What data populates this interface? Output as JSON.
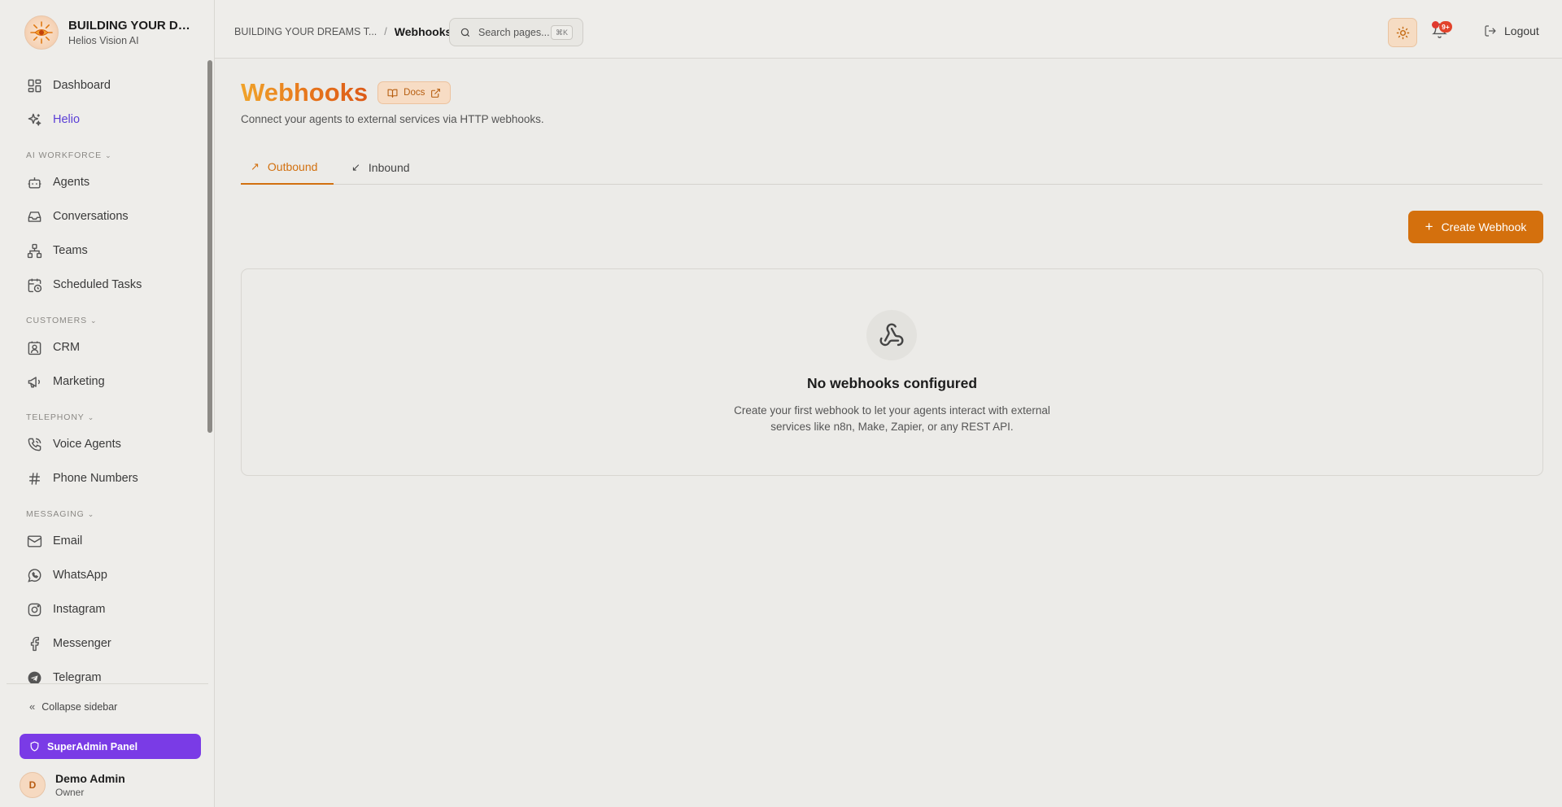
{
  "brand": {
    "title": "BUILDING YOUR DRE...",
    "subtitle": "Helios Vision AI"
  },
  "sidebar": {
    "items_top": [
      {
        "label": "Dashboard",
        "icon": "dashboard-icon"
      },
      {
        "label": "Helio",
        "icon": "sparkles-icon",
        "active": true
      }
    ],
    "sections": {
      "ai_workforce": "AI WORKFORCE",
      "customers": "CUSTOMERS",
      "telephony": "TELEPHONY",
      "messaging": "MESSAGING"
    },
    "ai_workforce_items": [
      {
        "label": "Agents",
        "icon": "bot-icon"
      },
      {
        "label": "Conversations",
        "icon": "inbox-icon"
      },
      {
        "label": "Teams",
        "icon": "network-icon"
      },
      {
        "label": "Scheduled Tasks",
        "icon": "calendar-clock-icon"
      }
    ],
    "customers_items": [
      {
        "label": "CRM",
        "icon": "contact-icon"
      },
      {
        "label": "Marketing",
        "icon": "megaphone-icon"
      }
    ],
    "telephony_items": [
      {
        "label": "Voice Agents",
        "icon": "phone-call-icon"
      },
      {
        "label": "Phone Numbers",
        "icon": "hash-icon"
      }
    ],
    "messaging_items": [
      {
        "label": "Email",
        "icon": "mail-icon"
      },
      {
        "label": "WhatsApp",
        "icon": "whatsapp-icon"
      },
      {
        "label": "Instagram",
        "icon": "instagram-icon"
      },
      {
        "label": "Messenger",
        "icon": "facebook-icon"
      },
      {
        "label": "Telegram",
        "icon": "telegram-icon"
      }
    ],
    "collapse_label": "Collapse sidebar",
    "superadmin_label": "SuperAdmin Panel",
    "user": {
      "initial": "D",
      "name": "Demo Admin",
      "role": "Owner"
    }
  },
  "header": {
    "breadcrumb_parent": "BUILDING YOUR DREAMS T...",
    "breadcrumb_sep": "/",
    "breadcrumb_current": "Webhooks",
    "search_placeholder": "Search pages...",
    "search_shortcut": "⌘K",
    "notification_badge": "9+",
    "logout_label": "Logout"
  },
  "main": {
    "title": "Webhooks",
    "docs_label": "Docs",
    "subtitle": "Connect your agents to external services via HTTP webhooks.",
    "tabs": [
      {
        "label": "Outbound",
        "active": true
      },
      {
        "label": "Inbound",
        "active": false
      }
    ],
    "create_button": "Create Webhook",
    "empty": {
      "title": "No webhooks configured",
      "line1": "Create your first webhook to let your agents interact with external",
      "line2": "services like n8n, Make, Zapier, or any REST API."
    }
  },
  "colors": {
    "accent": "#d4700d",
    "active_nav": "#5b3fd6",
    "superadmin": "#7a3be6"
  }
}
